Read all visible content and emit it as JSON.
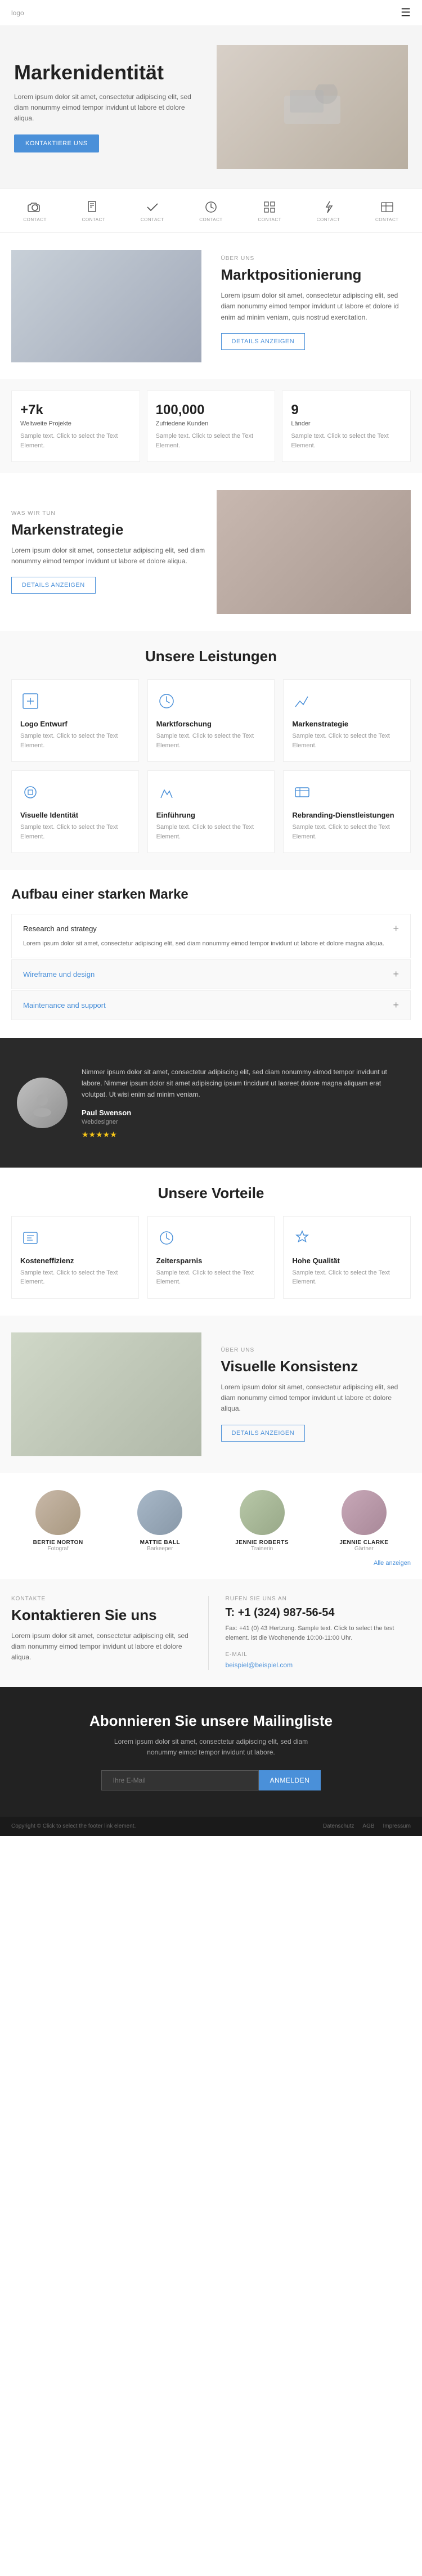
{
  "nav": {
    "logo": "logo",
    "menu_icon": "☰"
  },
  "hero": {
    "title": "Markenidentität",
    "description": "Lorem ipsum dolor sit amet, consectetur adipiscing elit, sed diam nonummy eimod tempor invidunt ut labore et dolore aliqua.",
    "button": "KONTAKTIERE UNS",
    "image_alt": "hero image"
  },
  "icons_row": [
    {
      "label": "CONTACT",
      "icon": "camera"
    },
    {
      "label": "CONTACT",
      "icon": "book"
    },
    {
      "label": "CONTACT",
      "icon": "checkmark"
    },
    {
      "label": "CONTACT",
      "icon": "clock"
    },
    {
      "label": "CONTACT",
      "icon": "grid"
    },
    {
      "label": "CONTACT",
      "icon": "lightning"
    },
    {
      "label": "CONTACT",
      "icon": "table"
    }
  ],
  "about": {
    "label": "ÜBER UNS",
    "title": "Marktpositionierung",
    "description": "Lorem ipsum dolor sit amet, consectetur adipiscing elit, sed diam nonummy eimod tempor invidunt ut labore et dolore id enim ad minim veniam, quis nostrud exercitation.",
    "button": "DETAILS ANZEIGEN"
  },
  "stats": [
    {
      "number": "+7k",
      "label": "Weltweite Projekte",
      "description": "Sample text. Click to select the Text Element."
    },
    {
      "number": "100,000",
      "label": "Zufriedene Kunden",
      "description": "Sample text. Click to select the Text Element."
    },
    {
      "number": "9",
      "label": "Länder",
      "description": "Sample text. Click to select the Text Element."
    }
  ],
  "strategy": {
    "was_wir": "WAS WIR TUN",
    "title": "Markenstrategie",
    "description": "Lorem ipsum dolor sit amet, consectetur adipiscing elit, sed diam nonummy eimod tempor invidunt ut labore et dolore aliqua.",
    "button": "DETAILS ANZEIGEN"
  },
  "leistungen": {
    "title": "Unsere Leistungen",
    "services": [
      {
        "title": "Logo Entwurf",
        "description": "Sample text. Click to select the Text Element."
      },
      {
        "title": "Marktforschung",
        "description": "Sample text. Click to select the Text Element."
      },
      {
        "title": "Markenstrategie",
        "description": "Sample text. Click to select the Text Element."
      },
      {
        "title": "Visuelle Identität",
        "description": "Sample text. Click to select the Text Element."
      },
      {
        "title": "Einführung",
        "description": "Sample text. Click to select the Text Element."
      },
      {
        "title": "Rebranding-Dienstleistungen",
        "description": "Sample text. Click to select the Text Element."
      }
    ]
  },
  "aufbau": {
    "title": "Aufbau einer starken Marke",
    "items": [
      {
        "title": "Research and strategy",
        "description": "Lorem ipsum dolor sit amet, consectetur adipiscing elit, sed diam nonummy eimod tempor invidunt ut labore et dolore magna aliqua.",
        "expanded": true
      },
      {
        "title": "Wireframe und design",
        "description": "",
        "expanded": false
      },
      {
        "title": "Maintenance and support",
        "description": "",
        "expanded": false
      }
    ]
  },
  "testimonial": {
    "text": "Nimmer ipsum dolor sit amet, consectetur adipiscing elit, sed diam nonummy eimod tempor invidunt ut labore. Nimmer ipsum dolor sit amet adipiscing ipsum tincidunt ut laoreet dolore magna aliquam erat volutpat. Ut wisi enim ad minim veniam.",
    "name": "Paul Swenson",
    "role": "Webdesigner",
    "stars": "★★★★★"
  },
  "vorteile": {
    "title": "Unsere Vorteile",
    "items": [
      {
        "title": "Kosteneffizienz",
        "description": "Sample text. Click to select the Text Element."
      },
      {
        "title": "Zeitersparnis",
        "description": "Sample text. Click to select the Text Element."
      },
      {
        "title": "Hohe Qualität",
        "description": "Sample text. Click to select the Text Element."
      }
    ]
  },
  "visual": {
    "label": "ÜBER UNS",
    "title": "Visuelle Konsistenz",
    "description": "Lorem ipsum dolor sit amet, consectetur adipiscing elit, sed diam nonummy eimod tempor invidunt ut labore et dolore aliqua.",
    "button": "DETAILS ANZEIGEN"
  },
  "team": {
    "see_more": "Alle anzeigen",
    "members": [
      {
        "name": "BERTIE NORTON",
        "role": "Fotograf"
      },
      {
        "name": "MATTIE BALL",
        "role": "Barkeeper"
      },
      {
        "name": "JENNIE ROBERTS",
        "role": "Trainerin"
      },
      {
        "name": "JENNIE CLARKE",
        "role": "Gärtner"
      }
    ],
    "avatar_colors": [
      "#c8b8a8",
      "#a8b8c8",
      "#b8c8a8",
      "#c8a8b8"
    ]
  },
  "contact": {
    "label": "KONTAKTE",
    "title": "Kontaktieren Sie uns",
    "description": "Lorem ipsum dolor sit amet, consectetur adipiscing elit, sed diam nonummy eimod tempor invidunt ut labore et dolore aliqua.",
    "call_label": "RUFEN SIE UNS AN",
    "phone": "T: +1 (324) 987-56-54",
    "phone_desc": "Fax: +41 (0) 43 Hertzung. Sample text. Click to select the test element. ist die Wochenende 10:00-11:00 Uhr.",
    "email_label": "E-MAIL",
    "email": "beispiel@beispiel.com"
  },
  "subscribe": {
    "title": "Abonnieren Sie unsere Mailingliste",
    "description": "Lorem ipsum dolor sit amet, consectetur adipiscing elit, sed diam nonummy eimod tempor invidunt ut labore.",
    "input_placeholder": "Ihre E-Mail",
    "button": "ANMELDEN"
  },
  "footer": {
    "copyright": "Copyright © Click to select the footer link element.",
    "links": [
      "Datenschutz",
      "AGB",
      "Impressum"
    ]
  }
}
